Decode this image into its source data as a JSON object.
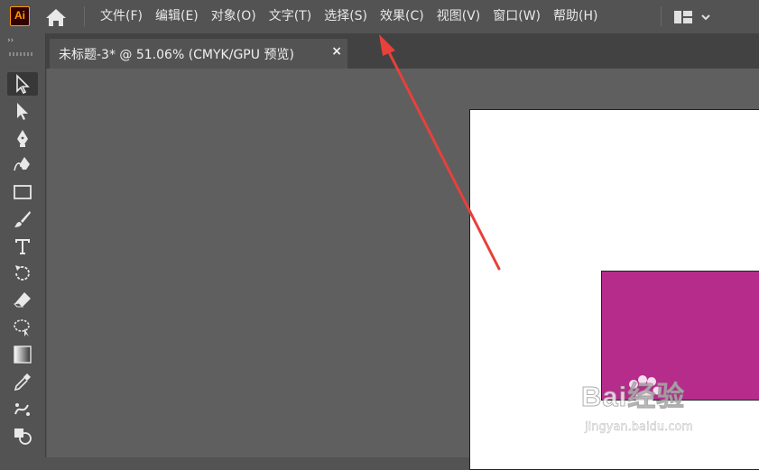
{
  "app": {
    "logo_text": "Ai"
  },
  "menu": {
    "items": [
      "文件(F)",
      "编辑(E)",
      "对象(O)",
      "文字(T)",
      "选择(S)",
      "效果(C)",
      "视图(V)",
      "窗口(W)",
      "帮助(H)"
    ]
  },
  "toolbar": {
    "collapse_label": "››",
    "tools": [
      "selection",
      "direct-selection",
      "pen",
      "curvature",
      "rectangle",
      "paintbrush",
      "type",
      "rotate",
      "eraser",
      "lasso",
      "gradient",
      "eyedropper",
      "puppet-warp",
      "shape-builder"
    ]
  },
  "document": {
    "tab_title": "未标题-3* @ 51.06% (CMYK/GPU 预览)",
    "close_label": "×"
  },
  "canvas": {
    "artboard_color": "#ffffff",
    "shape_color": "#b52c8b",
    "annotation_arrow_color": "#e8403a"
  },
  "watermark": {
    "logo_text": "Bai经验",
    "url": "jingyan.baidu.com"
  },
  "colors": {
    "ui_background": "#535353",
    "canvas_background": "#5f5f5f",
    "accent_logo": "#ff9a00"
  }
}
